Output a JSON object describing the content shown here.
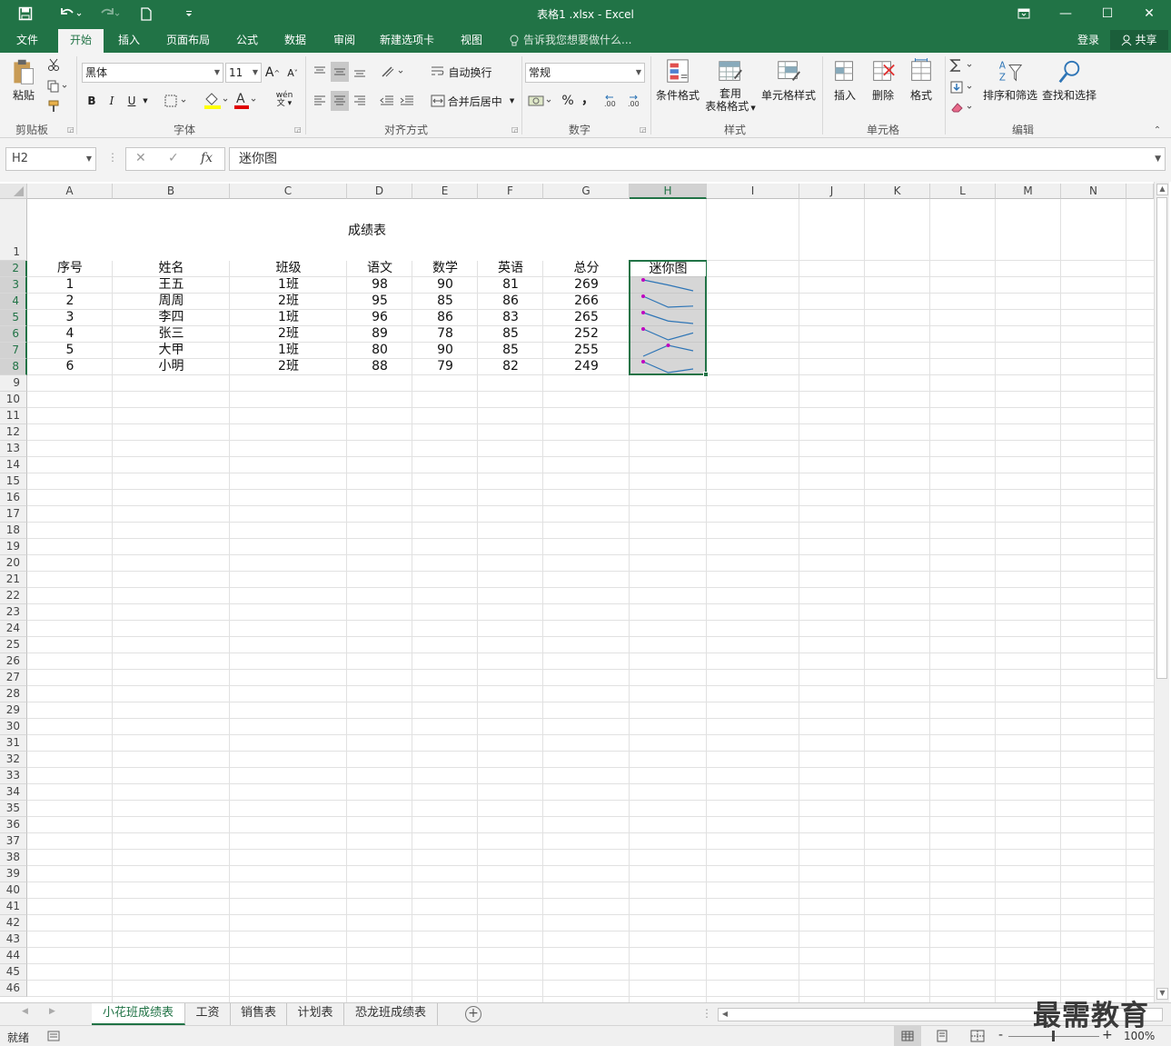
{
  "window": {
    "title": "表格1 .xlsx - Excel",
    "minimize": "—",
    "maximize": "☐",
    "close": "✕",
    "restore_ribbon": "⧉"
  },
  "ribbon_tabs": [
    "文件",
    "开始",
    "插入",
    "页面布局",
    "公式",
    "数据",
    "审阅",
    "新建选项卡",
    "视图"
  ],
  "tell_me": "告诉我您想要做什么...",
  "login": "登录",
  "share": "共享",
  "ribbon": {
    "clipboard": {
      "paste": "粘贴",
      "label": "剪贴板"
    },
    "font": {
      "name": "黑体",
      "size": "11",
      "bold": "B",
      "italic": "I",
      "underline": "U",
      "grow": "A",
      "shrink": "A",
      "label": "字体",
      "wen": "wén"
    },
    "alignment": {
      "wrap": "自动换行",
      "merge": "合并后居中",
      "label": "对齐方式"
    },
    "number": {
      "format": "常规",
      "percent": "%",
      "comma": "，",
      "label": "数字"
    },
    "styles": {
      "conditional": "条件格式",
      "table_line1": "套用",
      "table_line2": "表格格式",
      "cell_styles": "单元格样式",
      "label": "样式"
    },
    "cells": {
      "insert": "插入",
      "delete": "删除",
      "format": "格式",
      "label": "单元格"
    },
    "editing": {
      "sort": "排序和筛选",
      "find": "查找和选择",
      "label": "编辑"
    }
  },
  "formula_bar": {
    "name_box": "H2",
    "fx": "fx",
    "cancel": "✕",
    "enter": "✓",
    "content": "迷你图"
  },
  "columns": [
    "A",
    "B",
    "C",
    "D",
    "E",
    "F",
    "G",
    "H",
    "I",
    "J",
    "K",
    "L",
    "M",
    "N"
  ],
  "rows": [
    "1",
    "2",
    "3",
    "4",
    "5",
    "6",
    "7",
    "8",
    "9",
    "10",
    "11",
    "12",
    "13",
    "14",
    "15",
    "16",
    "17",
    "18",
    "19",
    "20",
    "21",
    "22",
    "23",
    "24",
    "25",
    "26",
    "27",
    "28",
    "29",
    "30",
    "31",
    "32",
    "33",
    "34",
    "35",
    "36",
    "37",
    "38",
    "39",
    "40",
    "41",
    "42",
    "43",
    "44",
    "45",
    "46"
  ],
  "table": {
    "title": "成绩表",
    "headers": [
      "序号",
      "姓名",
      "班级",
      "语文",
      "数学",
      "英语",
      "总分",
      "迷你图"
    ],
    "rows": [
      [
        "1",
        "王五",
        "1班",
        "98",
        "90",
        "81",
        "269"
      ],
      [
        "2",
        "周周",
        "2班",
        "95",
        "85",
        "86",
        "266"
      ],
      [
        "3",
        "李四",
        "1班",
        "96",
        "86",
        "83",
        "265"
      ],
      [
        "4",
        "张三",
        "2班",
        "89",
        "78",
        "85",
        "252"
      ],
      [
        "5",
        "大甲",
        "1班",
        "80",
        "90",
        "85",
        "255"
      ],
      [
        "6",
        "小明",
        "2班",
        "88",
        "79",
        "82",
        "249"
      ]
    ]
  },
  "sparklines": {
    "line_color": "#2e75b6",
    "high_point_color": "#c000c0",
    "series": [
      [
        98,
        90,
        81
      ],
      [
        95,
        85,
        86
      ],
      [
        96,
        86,
        83
      ],
      [
        89,
        78,
        85
      ],
      [
        80,
        90,
        85
      ],
      [
        88,
        79,
        82
      ]
    ]
  },
  "sheet_tabs": [
    "小花班成绩表",
    "工资",
    "销售表",
    "计划表",
    "恐龙班成绩表"
  ],
  "add_sheet": "+",
  "status": {
    "ready": "就绪",
    "zoom": "100%",
    "minus": "-",
    "plus": "+"
  },
  "watermark": "最需教育",
  "colors": {
    "accent": "#217346"
  }
}
